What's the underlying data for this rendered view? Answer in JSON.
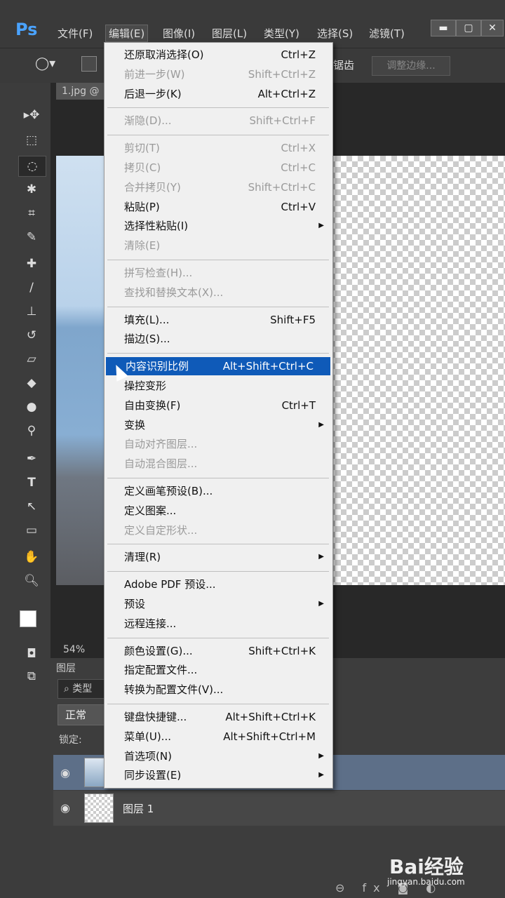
{
  "app": {
    "logo": "Ps",
    "menus": [
      "文件(F)",
      "编辑(E)",
      "图像(I)",
      "图层(L)",
      "类型(Y)",
      "选择(S)",
      "滤镜(T)"
    ],
    "window_controls": [
      "▬",
      "▢",
      "✕"
    ]
  },
  "options_bar": {
    "partial_label": "锯齿",
    "adjust_edge": "调整边缘..."
  },
  "document": {
    "tab_label": "1.jpg @",
    "zoom": "54%"
  },
  "edit_menu": [
    {
      "label": "还原取消选择(O)",
      "shortcut": "Ctrl+Z",
      "enabled": true
    },
    {
      "label": "前进一步(W)",
      "shortcut": "Shift+Ctrl+Z",
      "enabled": false
    },
    {
      "label": "后退一步(K)",
      "shortcut": "Alt+Ctrl+Z",
      "enabled": true
    },
    {
      "sep": true
    },
    {
      "label": "渐隐(D)...",
      "shortcut": "Shift+Ctrl+F",
      "enabled": false
    },
    {
      "sep": true
    },
    {
      "label": "剪切(T)",
      "shortcut": "Ctrl+X",
      "enabled": false
    },
    {
      "label": "拷贝(C)",
      "shortcut": "Ctrl+C",
      "enabled": false
    },
    {
      "label": "合并拷贝(Y)",
      "shortcut": "Shift+Ctrl+C",
      "enabled": false
    },
    {
      "label": "粘贴(P)",
      "shortcut": "Ctrl+V",
      "enabled": true
    },
    {
      "label": "选择性粘贴(I)",
      "submenu": true,
      "enabled": true
    },
    {
      "label": "清除(E)",
      "enabled": false
    },
    {
      "sep": true
    },
    {
      "label": "拼写检查(H)...",
      "enabled": false
    },
    {
      "label": "查找和替换文本(X)...",
      "enabled": false
    },
    {
      "sep": true
    },
    {
      "label": "填充(L)...",
      "shortcut": "Shift+F5",
      "enabled": true
    },
    {
      "label": "描边(S)...",
      "enabled": true
    },
    {
      "sep": true
    },
    {
      "label": "内容识别比例",
      "shortcut": "Alt+Shift+Ctrl+C",
      "enabled": true,
      "highlighted": true
    },
    {
      "label": "操控变形",
      "enabled": true
    },
    {
      "label": "自由变换(F)",
      "shortcut": "Ctrl+T",
      "enabled": true
    },
    {
      "label": "变换",
      "submenu": true,
      "enabled": true
    },
    {
      "label": "自动对齐图层...",
      "enabled": false
    },
    {
      "label": "自动混合图层...",
      "enabled": false
    },
    {
      "sep": true
    },
    {
      "label": "定义画笔预设(B)...",
      "enabled": true
    },
    {
      "label": "定义图案...",
      "enabled": true
    },
    {
      "label": "定义自定形状...",
      "enabled": false
    },
    {
      "sep": true
    },
    {
      "label": "清理(R)",
      "submenu": true,
      "enabled": true
    },
    {
      "sep": true
    },
    {
      "label": "Adobe PDF 预设...",
      "enabled": true
    },
    {
      "label": "预设",
      "submenu": true,
      "enabled": true
    },
    {
      "label": "远程连接...",
      "enabled": true
    },
    {
      "sep": true
    },
    {
      "label": "颜色设置(G)...",
      "shortcut": "Shift+Ctrl+K",
      "enabled": true
    },
    {
      "label": "指定配置文件...",
      "enabled": true
    },
    {
      "label": "转换为配置文件(V)...",
      "enabled": true
    },
    {
      "sep": true
    },
    {
      "label": "键盘快捷键...",
      "shortcut": "Alt+Shift+Ctrl+K",
      "enabled": true
    },
    {
      "label": "菜单(U)...",
      "shortcut": "Alt+Shift+Ctrl+M",
      "enabled": true
    },
    {
      "label": "首选项(N)",
      "submenu": true,
      "enabled": true
    },
    {
      "label": "同步设置(E)",
      "submenu": true,
      "enabled": true
    }
  ],
  "layers_panel": {
    "tab": "图层",
    "search_label": "类型",
    "blend_mode": "正常",
    "lock_label": "锁定:",
    "layers": [
      {
        "name": "",
        "selected": true
      },
      {
        "name": "图层 1",
        "selected": false
      }
    ]
  },
  "watermark": {
    "brand": "Bai经验",
    "url": "jingyan.baidu.com"
  }
}
